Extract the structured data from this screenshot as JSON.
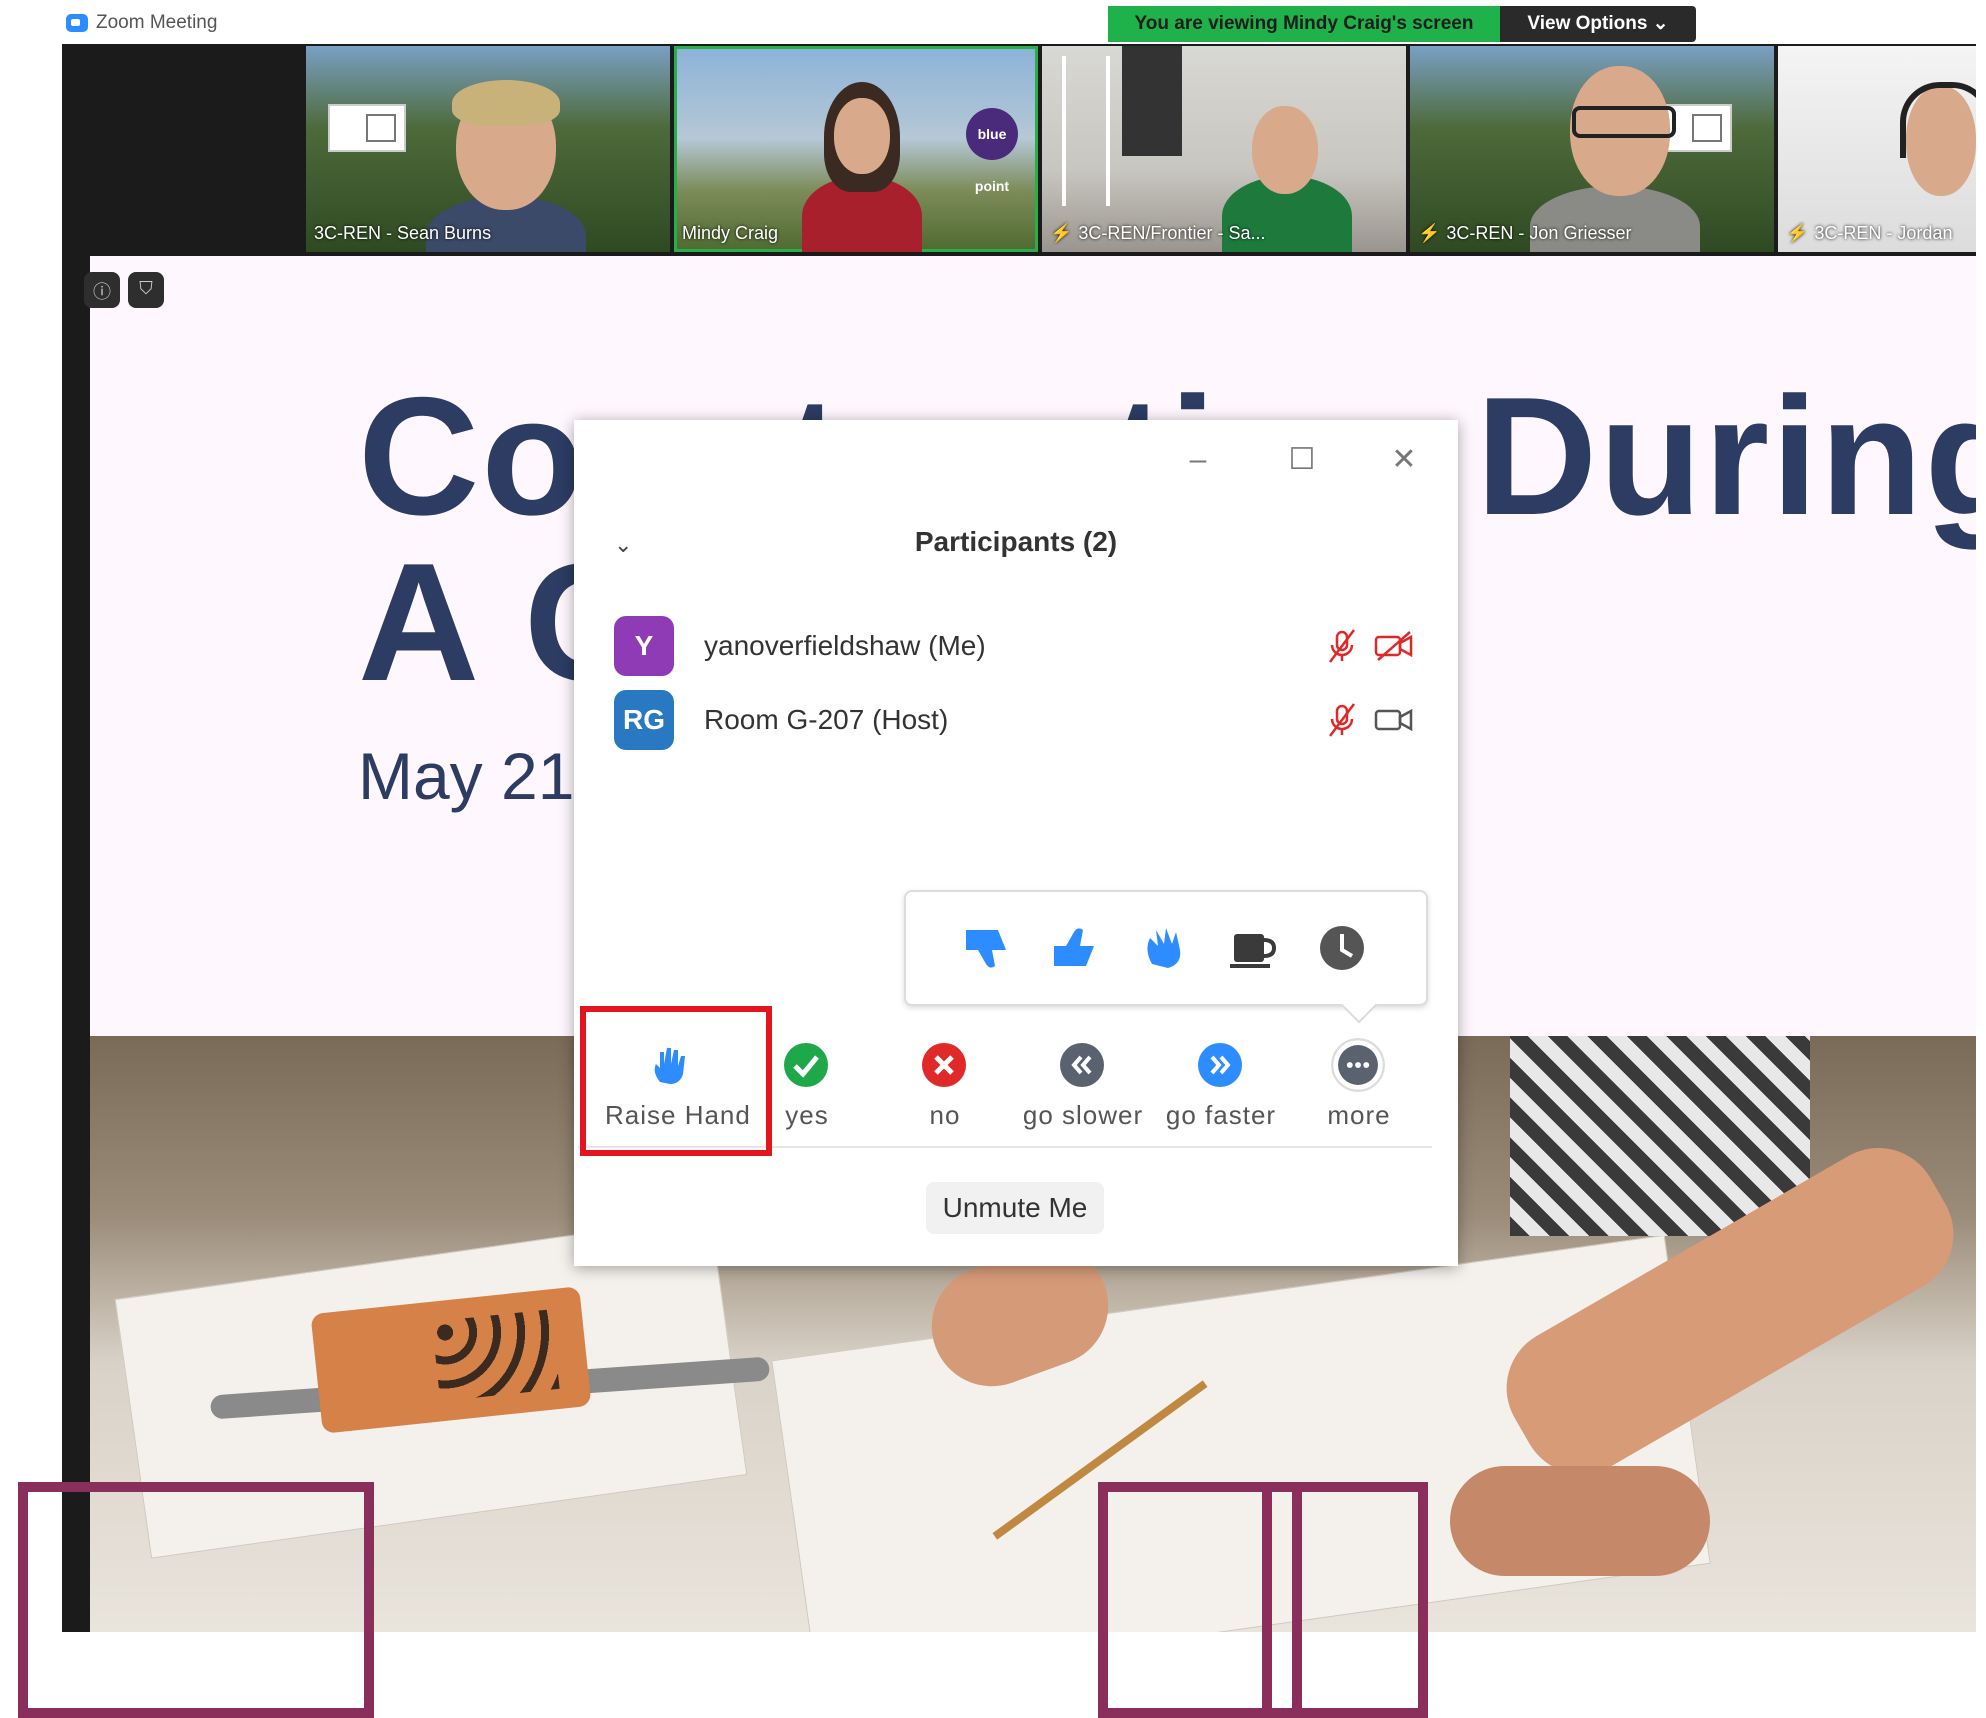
{
  "window": {
    "title": "Zoom Meeting"
  },
  "banner": {
    "viewing_text": "You are viewing Mindy Craig's screen",
    "view_options_label": "View Options ⌄"
  },
  "video_tiles": [
    {
      "name": "3C-REN - Sean Burns",
      "muted": false
    },
    {
      "name": "Mindy Craig",
      "muted": false,
      "active": true
    },
    {
      "name": "3C-REN/Frontier - Sa...",
      "muted": true
    },
    {
      "name": "3C-REN - Jon Griesser",
      "muted": true
    },
    {
      "name": "3C-REN - Jordan",
      "muted": true
    }
  ],
  "tile_logos": {
    "blue_point": "blue point"
  },
  "slide": {
    "title_line1": "Construction During",
    "title_line2": "A C",
    "date": "May 21,"
  },
  "participants_panel": {
    "title": "Participants (2)",
    "participants": [
      {
        "initials": "Y",
        "name": "yanoverfieldshaw (Me)",
        "avatar_color": "#8e3bb5",
        "mic": "muted",
        "video": "off"
      },
      {
        "initials": "RG",
        "name": "Room G-207 (Host)",
        "avatar_color": "#2979c2",
        "mic": "muted",
        "video": "on"
      }
    ],
    "reactions": [
      "thumbs-down",
      "thumbs-up",
      "clap",
      "coffee",
      "clock"
    ],
    "feedback": [
      {
        "label": "Raise Hand",
        "icon": "hand-icon"
      },
      {
        "label": "yes",
        "icon": "check-icon",
        "color": "#1fa84a"
      },
      {
        "label": "no",
        "icon": "x-icon",
        "color": "#e02a2a"
      },
      {
        "label": "go slower",
        "icon": "rewind-icon",
        "color": "#5a6270"
      },
      {
        "label": "go faster",
        "icon": "fast-forward-icon",
        "color": "#2d8cff"
      },
      {
        "label": "more",
        "icon": "more-icon",
        "color": "#5a6270"
      }
    ],
    "unmute_label": "Unmute Me"
  },
  "colors": {
    "accent": "#2d8cff",
    "highlight_red": "#e3151f",
    "overlay_purple": "#8a2e5c",
    "slide_text": "#2c3c63"
  }
}
